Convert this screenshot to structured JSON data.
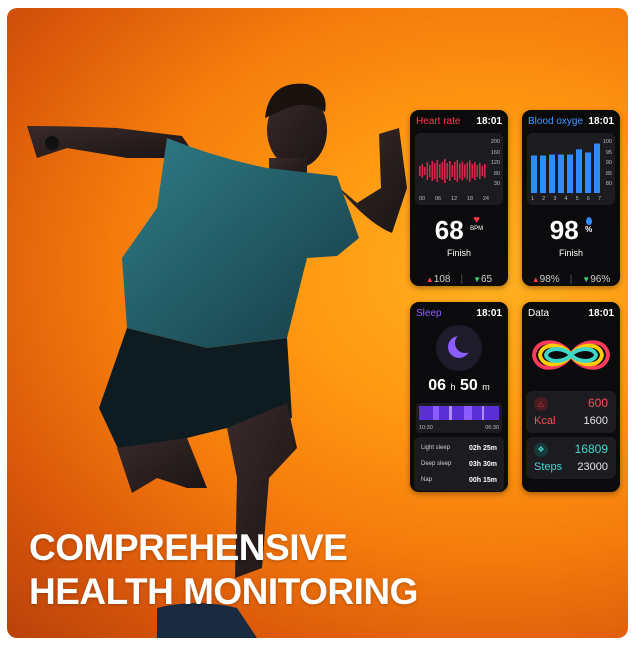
{
  "headline": {
    "line1": "COMPREHENSIVE",
    "line2": "HEALTH MONITORING"
  },
  "colors": {
    "heart_red": "#ff3b4a",
    "blood_blue": "#2f8cff",
    "sleep_purple": "#7a3cff",
    "steps_teal": "#49d6d0",
    "background_orange": "#f57b0c"
  },
  "cards": {
    "heart_rate": {
      "title": "Heart rate",
      "time": "18:01",
      "y_ticks": [
        "200",
        "160",
        "120",
        "80",
        "30"
      ],
      "x_ticks": [
        "00",
        "06",
        "12",
        "18",
        "24"
      ],
      "value": "68",
      "unit": "BPM",
      "icon": "heart-icon",
      "status": "Finish",
      "max": "108",
      "min": "65"
    },
    "blood_oxygen": {
      "title": "Blood oxyge",
      "time": "18:01",
      "y_ticks": [
        "100",
        "95",
        "90",
        "85",
        "80"
      ],
      "x_ticks": [
        "1",
        "2",
        "3",
        "4",
        "5",
        "6",
        "7"
      ],
      "bar_levels": [
        0.72,
        0.72,
        0.74,
        0.74,
        0.74,
        0.84,
        0.78,
        0.95
      ],
      "value": "98",
      "unit": "%",
      "icon": "blood-drop-icon",
      "status": "Finish",
      "max": "98%",
      "min": "96%"
    },
    "sleep": {
      "title": "Sleep",
      "time": "18:01",
      "icon": "moon-icon",
      "hours": "06",
      "h_unit": "h",
      "minutes": "50",
      "m_unit": "m",
      "start": "10:30",
      "end": "06:30",
      "rows": [
        {
          "label": "Light sleep",
          "value": "02h 25m"
        },
        {
          "label": "Deep sleep",
          "value": "03h 30m"
        },
        {
          "label": "Nap",
          "value": "00h 15m"
        }
      ]
    },
    "data": {
      "title": "Data",
      "time": "18:01",
      "kcal_value": "600",
      "kcal_label": "Kcal",
      "kcal_goal": "1600",
      "steps_value": "16809",
      "steps_label": "Steps",
      "steps_goal": "23000"
    }
  }
}
